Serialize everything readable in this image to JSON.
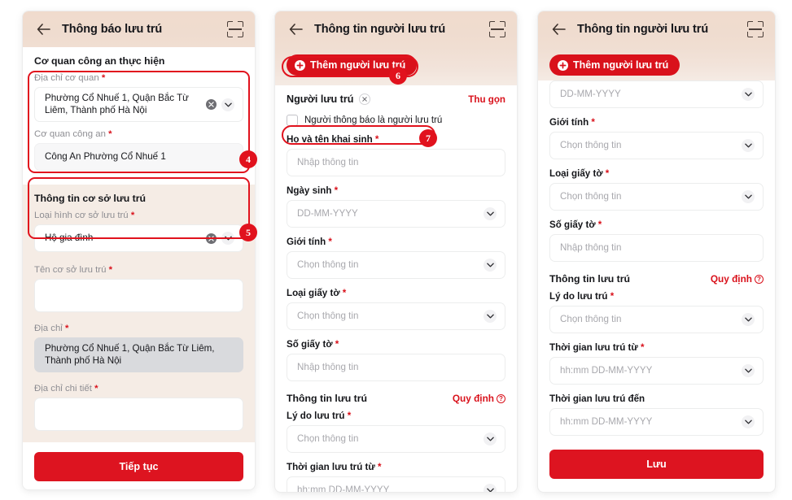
{
  "common": {
    "placeholder_enter": "Nhập thông tin",
    "placeholder_select": "Chọn thông tin",
    "placeholder_date": "DD-MM-YYYY",
    "placeholder_datetime": "hh:mm DD-MM-YYYY",
    "required_mark": "*",
    "back_icon": "arrow-left-icon",
    "scan_icon": "scan-qr-icon",
    "chevron_icon": "chevron-down-icon",
    "clear_icon": "clear-circle-icon",
    "accent_red": "#d9111b",
    "header_beige": "#f0ddd0",
    "form_beige": "#f5ece5",
    "disabled_gray": "#d9dadd"
  },
  "panel1": {
    "header": {
      "title": "Thông báo lưu trú"
    },
    "section_agency": {
      "title": "Cơ quan công an thực hiện"
    },
    "fields": {
      "agency_address": {
        "label": "Địa chỉ cơ quan",
        "value": "Phường Cổ Nhuế 1, Quận Bắc Từ Liêm, Thành phố Hà Nội"
      },
      "police_agency": {
        "label": "Cơ quan công an",
        "value": "Công An Phường Cổ Nhuế 1"
      }
    },
    "section_facility": {
      "title": "Thông tin cơ sở lưu trú"
    },
    "facility_fields": {
      "facility_type": {
        "label": "Loại hình cơ sở lưu trú",
        "value": "Hộ gia đình"
      },
      "facility_name": {
        "label": "Tên cơ sở lưu trú",
        "value": ""
      },
      "address": {
        "label": "Địa chỉ",
        "value": "Phường Cổ Nhuế 1, Quận Bắc Từ Liêm, Thành phố Hà Nội"
      },
      "address_detail": {
        "label": "Địa chỉ chi tiết",
        "value": ""
      }
    },
    "submit_label": "Tiếp tục",
    "badges": {
      "b4": "4",
      "b5": "5"
    }
  },
  "panel2": {
    "header": {
      "title": "Thông tin người lưu trú"
    },
    "add_button": {
      "label": "Thêm người lưu trú"
    },
    "person": {
      "name": "Người lưu trú",
      "collapse_label": "Thu gọn",
      "checkbox_label": "Người thông báo là người lưu trú"
    },
    "fields": [
      {
        "label": "Họ và tên khai sinh",
        "required": true,
        "type": "text",
        "placeholder": "Nhập thông tin"
      },
      {
        "label": "Ngày sinh",
        "required": true,
        "type": "date",
        "placeholder": "DD-MM-YYYY"
      },
      {
        "label": "Giới tính",
        "required": true,
        "type": "select",
        "placeholder": "Chọn thông tin"
      },
      {
        "label": "Loại giấy tờ",
        "required": true,
        "type": "select",
        "placeholder": "Chọn thông tin"
      },
      {
        "label": "Số giấy tờ",
        "required": true,
        "type": "text",
        "placeholder": "Nhập thông tin"
      }
    ],
    "stay_section": {
      "title": "Thông tin lưu trú",
      "rule_link": "Quy định"
    },
    "stay_fields": [
      {
        "label": "Lý do lưu trú",
        "required": true,
        "type": "select",
        "placeholder": "Chọn thông tin"
      },
      {
        "label": "Thời gian lưu trú từ",
        "required": true,
        "type": "datetime",
        "placeholder": "hh:mm DD-MM-YYYY"
      }
    ],
    "badges": {
      "b6": "6",
      "b7": "7"
    }
  },
  "panel3": {
    "header": {
      "title": "Thông tin người lưu trú"
    },
    "add_button": {
      "label": "Thêm người lưu trú"
    },
    "fields": [
      {
        "label": "",
        "required": false,
        "type": "date",
        "placeholder": "DD-MM-YYYY"
      },
      {
        "label": "Giới tính",
        "required": true,
        "type": "select",
        "placeholder": "Chọn thông tin"
      },
      {
        "label": "Loại giấy tờ",
        "required": true,
        "type": "select",
        "placeholder": "Chọn thông tin"
      },
      {
        "label": "Số giấy tờ",
        "required": true,
        "type": "text",
        "placeholder": "Nhập thông tin"
      }
    ],
    "stay_section": {
      "title": "Thông tin lưu trú",
      "rule_link": "Quy định"
    },
    "stay_fields": [
      {
        "label": "Lý do lưu trú",
        "required": true,
        "type": "select",
        "placeholder": "Chọn thông tin"
      },
      {
        "label": "Thời gian lưu trú từ",
        "required": true,
        "type": "datetime",
        "placeholder": "hh:mm DD-MM-YYYY"
      },
      {
        "label": "Thời gian lưu trú đến",
        "required": false,
        "type": "datetime",
        "placeholder": "hh:mm DD-MM-YYYY"
      }
    ],
    "save_label": "Lưu"
  }
}
